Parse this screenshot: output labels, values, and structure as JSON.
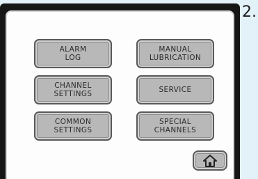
{
  "step_label": "2.",
  "menu": {
    "alarm_log": "ALARM\nLOG",
    "manual_lubrication": "MANUAL\nLUBRICATION",
    "channel_settings": "CHANNEL\nSETTINGS",
    "service": "SERVICE",
    "common_settings": "COMMON\nSETTINGS",
    "special_channels": "SPECIAL\nCHANNELS"
  },
  "icons": {
    "home": "home-icon"
  }
}
